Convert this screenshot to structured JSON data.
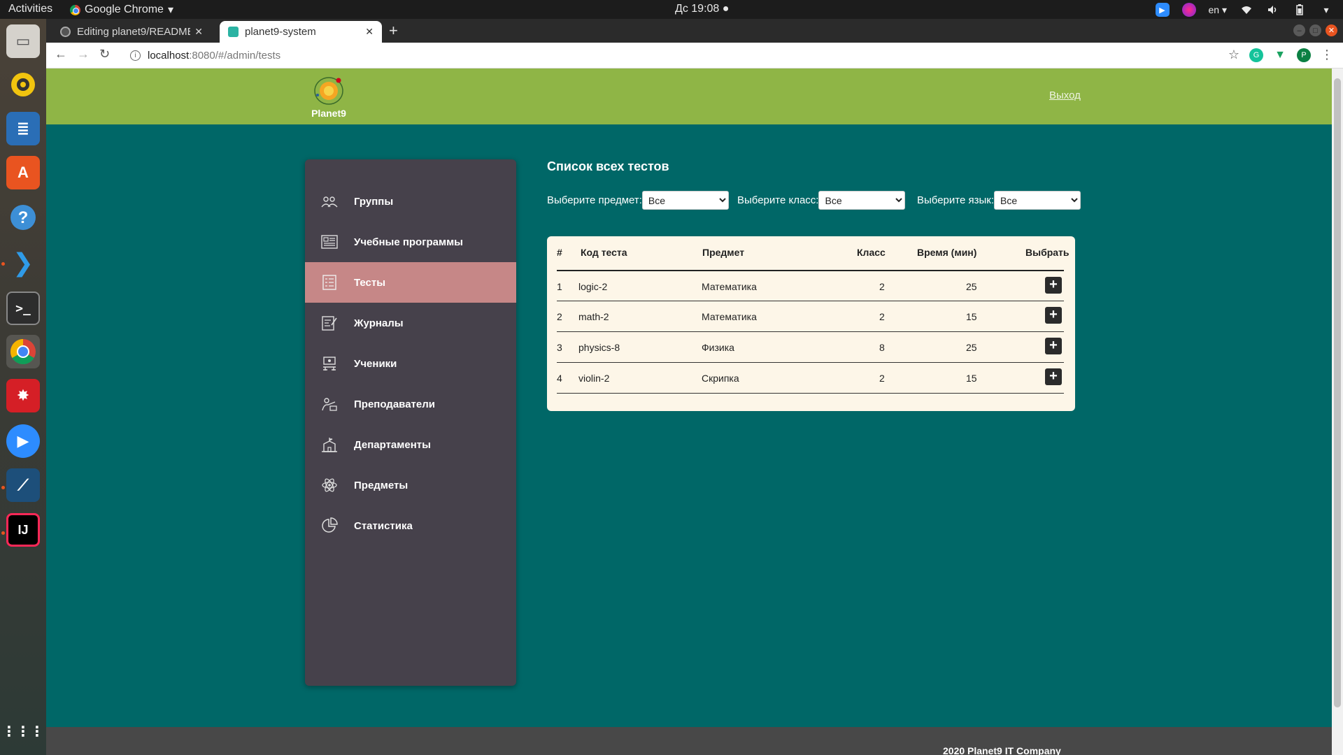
{
  "os": {
    "activities": "Activities",
    "app_name": "Google Chrome",
    "clock": "Дс 19:08",
    "lang": "en"
  },
  "browser": {
    "tabs": [
      {
        "title": "Editing planet9/README"
      },
      {
        "title": "planet9-system"
      }
    ],
    "url_host": "localhost",
    "url_path": ":8080/#/admin/tests",
    "profile_initial": "P"
  },
  "header": {
    "logo_text": "Planet9",
    "logout": "Выход"
  },
  "sidebar": {
    "items": [
      {
        "label": "Группы",
        "icon": "groups-icon"
      },
      {
        "label": "Учебные программы",
        "icon": "curriculum-icon"
      },
      {
        "label": "Тесты",
        "icon": "tests-icon",
        "active": true
      },
      {
        "label": "Журналы",
        "icon": "journals-icon"
      },
      {
        "label": "Ученики",
        "icon": "students-icon"
      },
      {
        "label": "Преподаватели",
        "icon": "teachers-icon"
      },
      {
        "label": "Департаменты",
        "icon": "departments-icon"
      },
      {
        "label": "Предметы",
        "icon": "subjects-icon"
      },
      {
        "label": "Статистика",
        "icon": "statistics-icon"
      }
    ]
  },
  "content": {
    "title": "Список всех тестов",
    "filters": [
      {
        "label": "Выберите предмет:",
        "value": "Все"
      },
      {
        "label": "Выберите класс:",
        "value": "Все"
      },
      {
        "label": "Выберите язык:",
        "value": "Все"
      }
    ],
    "table": {
      "headers": [
        "#",
        "Код теста",
        "Предмет",
        "Класс",
        "Время (мин)",
        "Выбрать"
      ],
      "rows": [
        [
          "1",
          "logic-2",
          "Математика",
          "2",
          "25"
        ],
        [
          "2",
          "math-2",
          "Математика",
          "2",
          "15"
        ],
        [
          "3",
          "physics-8",
          "Физика",
          "8",
          "25"
        ],
        [
          "4",
          "violin-2",
          "Скрипка",
          "2",
          "15"
        ]
      ]
    }
  },
  "footer": {
    "text": "2020 Planet9 IT Company"
  },
  "colors": {
    "header_green": "#8fb546",
    "page_teal": "#006767",
    "sidebar_bg": "#46414b",
    "active_item": "#c68787",
    "table_bg": "#fdf6e8"
  }
}
